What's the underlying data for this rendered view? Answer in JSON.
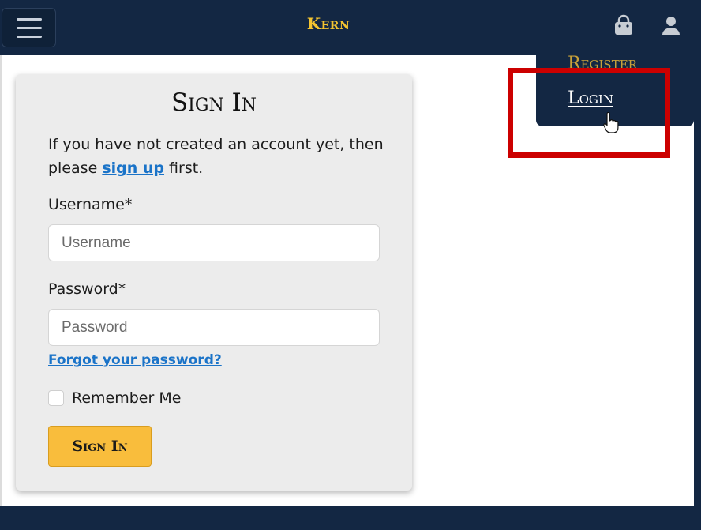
{
  "nav": {
    "brand": "Kern",
    "icons": [
      "menu-icon",
      "shopping-bag-icon",
      "user-icon"
    ],
    "dropdown": {
      "register_label": "Register",
      "login_label": "Login"
    }
  },
  "signin": {
    "title": "Sign In",
    "intro_before": "If you have not created an account yet, then please ",
    "signup_link": "sign up",
    "intro_after": " first.",
    "username_label": "Username*",
    "username_placeholder": "Username",
    "password_label": "Password*",
    "password_placeholder": "Password",
    "forgot_link": "Forgot your password?",
    "remember_label": "Remember Me",
    "submit_label": "Sign In"
  },
  "colors": {
    "navbar": "#132743",
    "brand": "#f4c430",
    "button": "#f9bd3c",
    "link": "#1a73c8",
    "highlight": "#cc0000"
  }
}
